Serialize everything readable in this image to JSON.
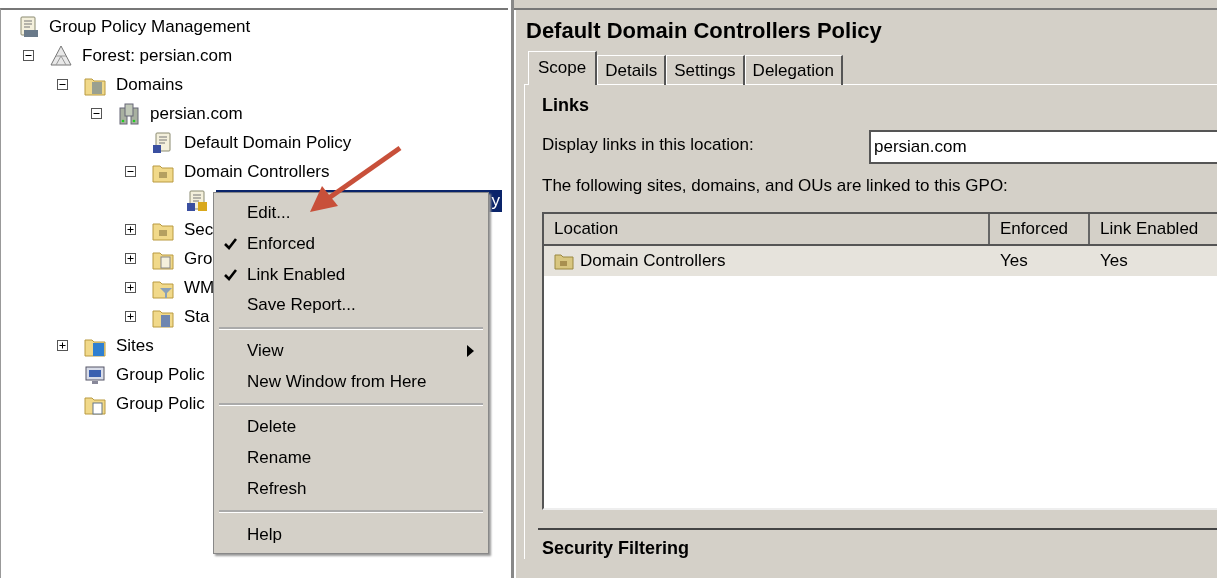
{
  "tree": {
    "label": "Group Policy Management",
    "kind": "console",
    "children": [
      {
        "label": "Forest: persian.com",
        "kind": "forest",
        "expanded": true,
        "children": [
          {
            "label": "Domains",
            "kind": "domains",
            "expanded": true,
            "children": [
              {
                "label": "persian.com",
                "kind": "domain",
                "expanded": true,
                "children": [
                  {
                    "label": "Default Domain Policy",
                    "kind": "gpo-link",
                    "selected": false
                  },
                  {
                    "label": "Domain Controllers",
                    "kind": "ou",
                    "expanded": true,
                    "selected": false,
                    "children": [
                      {
                        "label": "y",
                        "kind": "gpo-link",
                        "selected": true
                      }
                    ]
                  },
                  {
                    "label": "Sec",
                    "kind": "ou",
                    "expanded": false,
                    "selected": false
                  },
                  {
                    "label": "Gro",
                    "kind": "gpo-folder",
                    "expanded": false,
                    "selected": false
                  },
                  {
                    "label": "WM",
                    "kind": "filter-folder",
                    "expanded": false,
                    "selected": false
                  },
                  {
                    "label": "Sta",
                    "kind": "starter-folder",
                    "expanded": false,
                    "selected": false
                  }
                ]
              }
            ]
          },
          {
            "label": "Sites",
            "kind": "sites",
            "expanded": false,
            "selected": false
          },
          {
            "label": "Group Polic",
            "kind": "modeling",
            "selected": false
          },
          {
            "label": "Group Polic",
            "kind": "results",
            "selected": false
          }
        ]
      }
    ]
  },
  "context_menu": [
    {
      "kind": "item",
      "label": "Edit...",
      "checked": false,
      "submenu": false
    },
    {
      "kind": "item",
      "label": "Enforced",
      "checked": true,
      "submenu": false
    },
    {
      "kind": "item",
      "label": "Link Enabled",
      "checked": true,
      "submenu": false
    },
    {
      "kind": "item",
      "label": "Save Report...",
      "checked": false,
      "submenu": false
    },
    {
      "kind": "separator"
    },
    {
      "kind": "item",
      "label": "View",
      "checked": false,
      "submenu": true
    },
    {
      "kind": "item",
      "label": "New Window from Here",
      "checked": false,
      "submenu": false
    },
    {
      "kind": "separator"
    },
    {
      "kind": "item",
      "label": "Delete",
      "checked": false,
      "submenu": false
    },
    {
      "kind": "item",
      "label": "Rename",
      "checked": false,
      "submenu": false
    },
    {
      "kind": "item",
      "label": "Refresh",
      "checked": false,
      "submenu": false
    },
    {
      "kind": "separator"
    },
    {
      "kind": "item",
      "label": "Help",
      "checked": false,
      "submenu": false
    }
  ],
  "details": {
    "title": "Default Domain Controllers Policy",
    "tabs": [
      {
        "label": "Scope",
        "selected": true
      },
      {
        "label": "Details",
        "selected": false
      },
      {
        "label": "Settings",
        "selected": false
      },
      {
        "label": "Delegation",
        "selected": false
      }
    ],
    "links_heading": "Links",
    "location_label": "Display links in this location:",
    "location_value": "persian.com",
    "linked_caption": "The following sites, domains, and OUs are linked to this GPO:",
    "table": {
      "columns": [
        "Location",
        "Enforced",
        "Link Enabled"
      ],
      "rows": [
        {
          "cells": [
            "Domain Controllers",
            "Yes",
            "Yes"
          ],
          "selected": true
        }
      ]
    },
    "security_heading": "Security Filtering"
  }
}
